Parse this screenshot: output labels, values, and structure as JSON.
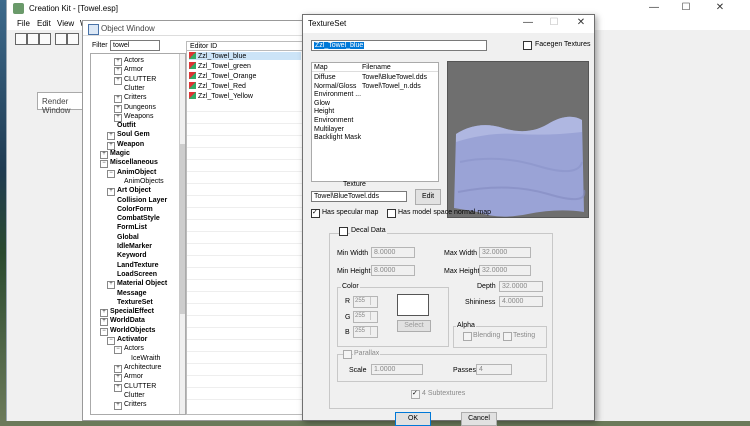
{
  "creation_kit": {
    "title": "Creation Kit - [Towel.esp]",
    "menu": [
      "File",
      "Edit",
      "View",
      "W"
    ]
  },
  "render_window": {
    "title": "Render Window"
  },
  "object_window": {
    "title": "Object Window",
    "filter_label": "Filter",
    "filter_value": "towel",
    "column_header": "Editor ID",
    "tree": [
      {
        "label": "Actors",
        "indent": 3,
        "exp": "+",
        "bold": false
      },
      {
        "label": "Armor",
        "indent": 3,
        "exp": "+",
        "bold": false
      },
      {
        "label": "CLUTTER",
        "indent": 3,
        "exp": "+",
        "bold": false
      },
      {
        "label": "Clutter",
        "indent": 3,
        "exp": "",
        "bold": false
      },
      {
        "label": "Critters",
        "indent": 3,
        "exp": "+",
        "bold": false
      },
      {
        "label": "Dungeons",
        "indent": 3,
        "exp": "+",
        "bold": false
      },
      {
        "label": "Weapons",
        "indent": 3,
        "exp": "+",
        "bold": false
      },
      {
        "label": "Outfit",
        "indent": 2,
        "exp": "",
        "bold": true
      },
      {
        "label": "Soul Gem",
        "indent": 2,
        "exp": "+",
        "bold": true
      },
      {
        "label": "Weapon",
        "indent": 2,
        "exp": "+",
        "bold": true
      },
      {
        "label": "Magic",
        "indent": 1,
        "exp": "+",
        "bold": true
      },
      {
        "label": "Miscellaneous",
        "indent": 1,
        "exp": "-",
        "bold": true
      },
      {
        "label": "AnimObject",
        "indent": 2,
        "exp": "-",
        "bold": true
      },
      {
        "label": "AnimObjects",
        "indent": 3,
        "exp": "",
        "bold": false
      },
      {
        "label": "Art Object",
        "indent": 2,
        "exp": "+",
        "bold": true
      },
      {
        "label": "Collision Layer",
        "indent": 2,
        "exp": "",
        "bold": true
      },
      {
        "label": "ColorForm",
        "indent": 2,
        "exp": "",
        "bold": true
      },
      {
        "label": "CombatStyle",
        "indent": 2,
        "exp": "",
        "bold": true
      },
      {
        "label": "FormList",
        "indent": 2,
        "exp": "",
        "bold": true
      },
      {
        "label": "Global",
        "indent": 2,
        "exp": "",
        "bold": true
      },
      {
        "label": "IdleMarker",
        "indent": 2,
        "exp": "",
        "bold": true
      },
      {
        "label": "Keyword",
        "indent": 2,
        "exp": "",
        "bold": true
      },
      {
        "label": "LandTexture",
        "indent": 2,
        "exp": "",
        "bold": true
      },
      {
        "label": "LoadScreen",
        "indent": 2,
        "exp": "",
        "bold": true
      },
      {
        "label": "Material Object",
        "indent": 2,
        "exp": "+",
        "bold": true
      },
      {
        "label": "Message",
        "indent": 2,
        "exp": "",
        "bold": true
      },
      {
        "label": "TextureSet",
        "indent": 2,
        "exp": "",
        "bold": true
      },
      {
        "label": "SpecialEffect",
        "indent": 1,
        "exp": "+",
        "bold": true
      },
      {
        "label": "WorldData",
        "indent": 1,
        "exp": "+",
        "bold": true
      },
      {
        "label": "WorldObjects",
        "indent": 1,
        "exp": "-",
        "bold": true
      },
      {
        "label": "Activator",
        "indent": 2,
        "exp": "-",
        "bold": true
      },
      {
        "label": "Actors",
        "indent": 3,
        "exp": "-",
        "bold": false
      },
      {
        "label": "IceWraith",
        "indent": 4,
        "exp": "",
        "bold": false
      },
      {
        "label": "Architecture",
        "indent": 3,
        "exp": "+",
        "bold": false
      },
      {
        "label": "Armor",
        "indent": 3,
        "exp": "+",
        "bold": false
      },
      {
        "label": "CLUTTER",
        "indent": 3,
        "exp": "+",
        "bold": false
      },
      {
        "label": "Clutter",
        "indent": 3,
        "exp": "",
        "bold": false
      },
      {
        "label": "Critters",
        "indent": 3,
        "exp": "+",
        "bold": false
      }
    ],
    "items": [
      "Zzl_Towel_blue",
      "Zzl_Towel_green",
      "Zzl_Towel_Orange",
      "Zzl_Towel_Red",
      "Zzl_Towel_Yellow"
    ]
  },
  "textureset": {
    "title": "TextureSet",
    "editor_id": "Zzl_Towel_blue",
    "facegen_label": "Facegen Textures",
    "map_header": "Map",
    "filename_header": "Filename",
    "maps": [
      {
        "map": "Diffuse",
        "file": "Towel\\BlueTowel.dds"
      },
      {
        "map": "Normal/Gloss",
        "file": "Towel\\Towel_n.dds"
      },
      {
        "map": "Environment ...",
        "file": ""
      },
      {
        "map": "Glow",
        "file": ""
      },
      {
        "map": "Height",
        "file": ""
      },
      {
        "map": "Environment",
        "file": ""
      },
      {
        "map": "Multilayer",
        "file": ""
      },
      {
        "map": "Backlight Mask",
        "file": ""
      }
    ],
    "texture_label": "Texture",
    "texture_value": "Towel\\BlueTowel.dds",
    "edit_label": "Edit",
    "specular_label": "Has specular map",
    "model_normal_label": "Has model space normal map",
    "decal_label": "Decal Data",
    "min_width_label": "Min Width",
    "min_width": "8.0000",
    "max_width_label": "Max Width",
    "max_width": "32.0000",
    "min_height_label": "Min Height",
    "min_height": "8.0000",
    "max_height_label": "Max Height",
    "max_height": "32.0000",
    "depth_label": "Depth",
    "depth": "32.0000",
    "shininess_label": "Shininess",
    "shininess": "4.0000",
    "color_label": "Color",
    "r_label": "R",
    "g_label": "G",
    "b_label": "B",
    "r": "255",
    "g": "255",
    "b": "255",
    "select_label": "Select",
    "alpha_label": "Alpha",
    "blending_label": "Blending",
    "testing_label": "Testing",
    "parallax_label": "Parallax",
    "scale_label": "Scale",
    "scale": "1.0000",
    "passes_label": "Passes",
    "passes": "4",
    "subtextures_label": "4 Subtextures",
    "ok_label": "OK",
    "cancel_label": "Cancel"
  }
}
